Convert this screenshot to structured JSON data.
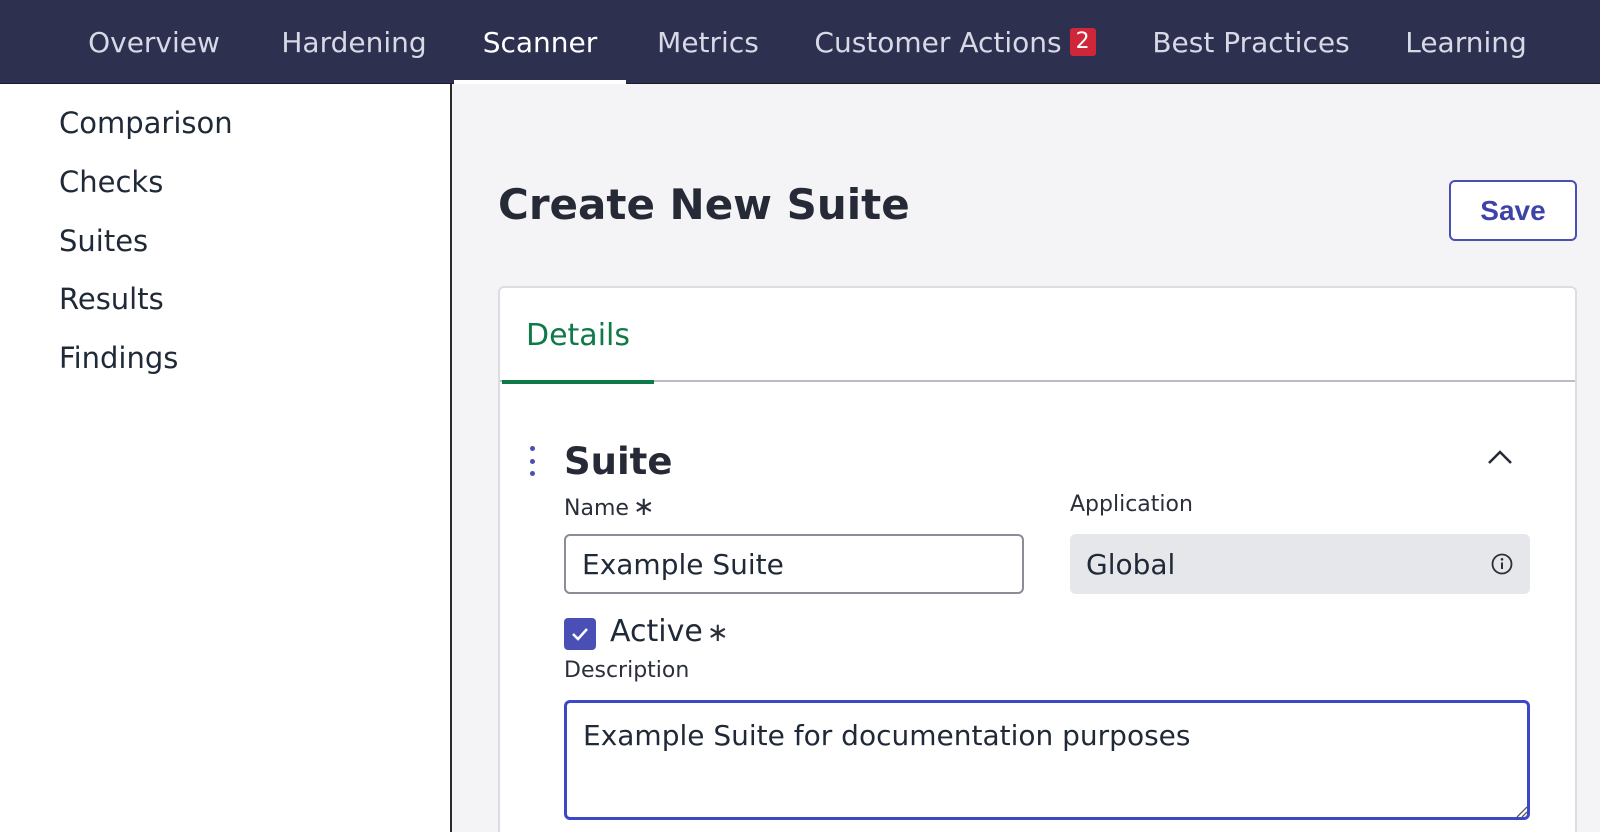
{
  "topnav": {
    "tabs": [
      {
        "label": "Overview",
        "active": false
      },
      {
        "label": "Hardening",
        "active": false
      },
      {
        "label": "Scanner",
        "active": true
      },
      {
        "label": "Metrics",
        "active": false
      },
      {
        "label": "Customer Actions",
        "badge": "2",
        "active": false
      },
      {
        "label": "Best Practices",
        "active": false
      },
      {
        "label": "Learning",
        "active": false
      }
    ],
    "badge_color": "#d0263a",
    "background": "#2e3050"
  },
  "sidebar": {
    "items": [
      "Comparison",
      "Checks",
      "Suites",
      "Results",
      "Findings"
    ]
  },
  "main": {
    "title": "Create New Suite",
    "save_label": "Save",
    "card": {
      "tab_label": "Details",
      "section_title": "Suite",
      "name_label": "Name",
      "required_mark": "∗",
      "name_value": "Example Suite",
      "application_label": "Application",
      "application_value": "Global",
      "active_label": "Active",
      "active_checked": true,
      "description_label": "Description",
      "description_value": "Example Suite for documentation purposes"
    }
  },
  "colors": {
    "accent": "#4a4fb5",
    "tab_active": "#0f7a47",
    "focus": "#3c48c8"
  }
}
